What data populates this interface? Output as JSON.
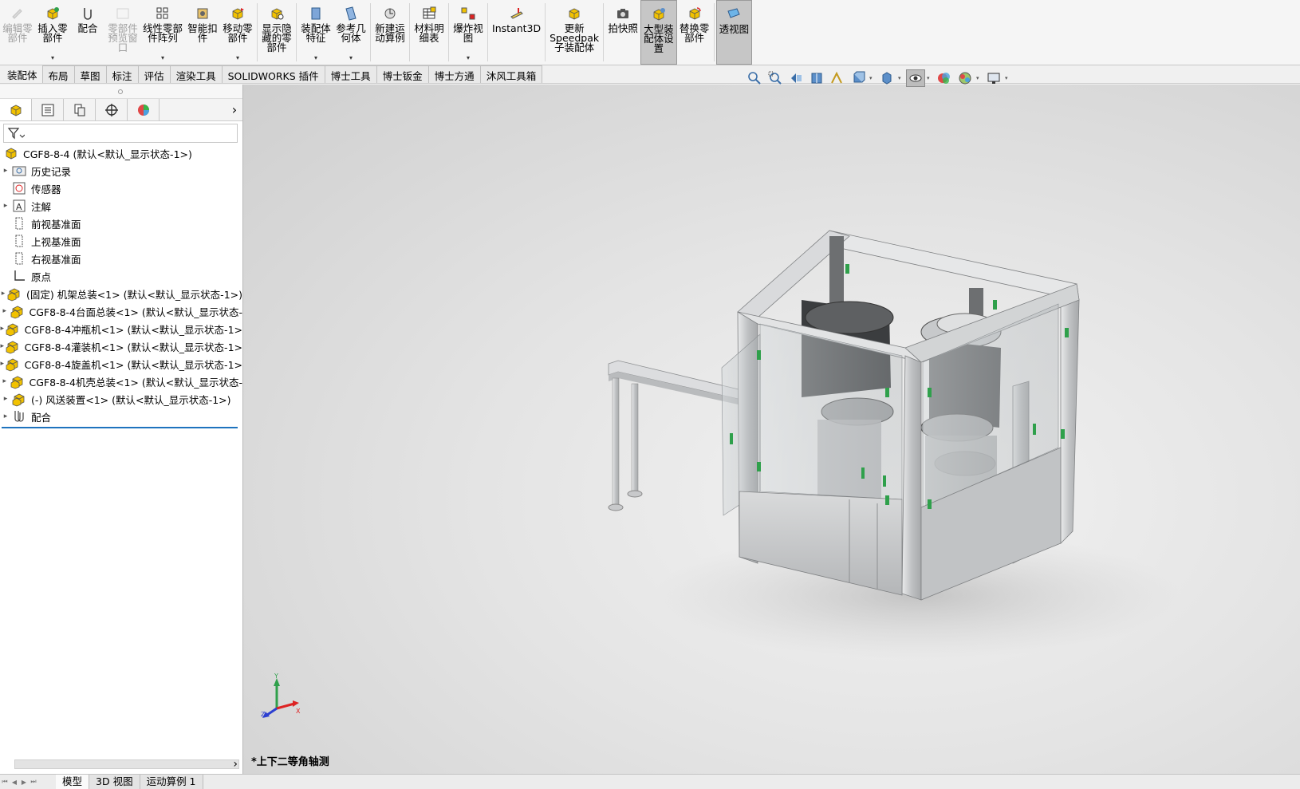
{
  "ribbon": {
    "buttons": [
      {
        "id": "edit-component",
        "label": "编辑零\n部件",
        "icon": "edit-component-icon",
        "disabled": true,
        "dropdown": false
      },
      {
        "id": "insert-component",
        "label": "插入零\n部件",
        "icon": "insert-component-icon",
        "disabled": false,
        "dropdown": true
      },
      {
        "id": "mate",
        "label": "配合",
        "icon": "mate-icon",
        "disabled": false,
        "dropdown": false
      },
      {
        "id": "component-preview",
        "label": "零部件\n预览窗\n口",
        "icon": "component-preview-icon",
        "disabled": true,
        "dropdown": false
      },
      {
        "id": "linear-pattern",
        "label": "线性零部\n件阵列",
        "icon": "linear-pattern-icon",
        "disabled": false,
        "dropdown": true
      },
      {
        "id": "smart-fasteners",
        "label": "智能扣\n件",
        "icon": "smart-fasteners-icon",
        "disabled": false,
        "dropdown": false
      },
      {
        "id": "move-component",
        "label": "移动零\n部件",
        "icon": "move-component-icon",
        "disabled": false,
        "dropdown": true
      },
      {
        "id": "show-hidden",
        "label": "显示隐\n藏的零\n部件",
        "icon": "show-hidden-icon",
        "disabled": false,
        "dropdown": false,
        "sep_before": true
      },
      {
        "id": "assembly-features",
        "label": "装配体\n特征",
        "icon": "assembly-features-icon",
        "disabled": false,
        "dropdown": true,
        "sep_before": true
      },
      {
        "id": "reference-geometry",
        "label": "参考几\n何体",
        "icon": "reference-geometry-icon",
        "disabled": false,
        "dropdown": true
      },
      {
        "id": "new-motion-study",
        "label": "新建运\n动算例",
        "icon": "motion-study-icon",
        "disabled": false,
        "dropdown": false,
        "sep_before": true
      },
      {
        "id": "bom",
        "label": "材料明\n细表",
        "icon": "bom-icon",
        "disabled": false,
        "dropdown": false,
        "sep_before": true
      },
      {
        "id": "exploded-view",
        "label": "爆炸视\n图",
        "icon": "exploded-view-icon",
        "disabled": false,
        "dropdown": true,
        "sep_before": true
      },
      {
        "id": "instant3d",
        "label": "Instant3D",
        "icon": "instant3d-icon",
        "disabled": false,
        "dropdown": false,
        "sep_before": true
      },
      {
        "id": "update-speedpak",
        "label": "更新\nSpeedpak\n子装配体",
        "icon": "speedpak-icon",
        "disabled": false,
        "dropdown": false,
        "sep_before": true
      },
      {
        "id": "snapshot",
        "label": "拍快照",
        "icon": "camera-icon",
        "disabled": false,
        "dropdown": false,
        "sep_before": true
      },
      {
        "id": "large-assembly",
        "label": "大型装\n配体设\n置",
        "icon": "large-assembly-icon",
        "disabled": false,
        "dropdown": false,
        "active": true
      },
      {
        "id": "replace-components",
        "label": "替换零\n部件",
        "icon": "replace-components-icon",
        "disabled": false,
        "dropdown": false
      },
      {
        "id": "perspective",
        "label": "透视图",
        "icon": "perspective-icon",
        "disabled": false,
        "dropdown": false,
        "active": true,
        "sep_before": true
      }
    ]
  },
  "command_tabs": [
    "装配体",
    "布局",
    "草图",
    "标注",
    "评估",
    "渲染工具",
    "SOLIDWORKS 插件",
    "博士工具",
    "博士钣金",
    "博士方通",
    "沐风工具箱"
  ],
  "heads_up": [
    {
      "icon": "zoom-to-fit-icon"
    },
    {
      "icon": "zoom-to-area-icon"
    },
    {
      "icon": "previous-view-icon"
    },
    {
      "icon": "section-view-icon"
    },
    {
      "icon": "dynamic-annotation-icon"
    },
    {
      "icon": "view-orientation-icon",
      "dropdown": true
    },
    {
      "icon": "display-style-icon",
      "dropdown": true
    },
    {
      "icon": "hide-show-items-icon",
      "dropdown": true,
      "selected": true
    },
    {
      "icon": "edit-appearance-icon",
      "dropdown": false
    },
    {
      "icon": "apply-scene-icon",
      "dropdown": true
    },
    {
      "icon": "view-settings-icon",
      "dropdown": true
    }
  ],
  "manager_tabs": [
    {
      "icon": "feature-manager-icon",
      "active": true
    },
    {
      "icon": "property-manager-icon"
    },
    {
      "icon": "configuration-manager-icon"
    },
    {
      "icon": "dimxpert-manager-icon"
    },
    {
      "icon": "display-manager-icon"
    }
  ],
  "tree": {
    "root": "CGF8-8-4  (默认<默认_显示状态-1>)",
    "items": [
      {
        "label": "历史记录",
        "icon": "history-folder-icon",
        "expandable": true
      },
      {
        "label": "传感器",
        "icon": "sensors-icon",
        "expandable": false
      },
      {
        "label": "注解",
        "icon": "annotations-icon",
        "expandable": true
      },
      {
        "label": "前视基准面",
        "icon": "plane-icon",
        "expandable": false
      },
      {
        "label": "上视基准面",
        "icon": "plane-icon",
        "expandable": false
      },
      {
        "label": "右视基准面",
        "icon": "plane-icon",
        "expandable": false
      },
      {
        "label": "原点",
        "icon": "origin-icon",
        "expandable": false
      },
      {
        "label": "(固定) 机架总装<1> (默认<默认_显示状态-1>)",
        "icon": "subassembly-icon",
        "expandable": true
      },
      {
        "label": "CGF8-8-4台面总装<1> (默认<默认_显示状态-",
        "icon": "subassembly-icon",
        "expandable": true
      },
      {
        "label": "CGF8-8-4冲瓶机<1> (默认<默认_显示状态-1>",
        "icon": "subassembly-icon",
        "expandable": true
      },
      {
        "label": "CGF8-8-4灌装机<1> (默认<默认_显示状态-1>",
        "icon": "subassembly-icon",
        "expandable": true
      },
      {
        "label": "CGF8-8-4旋盖机<1> (默认<默认_显示状态-1>",
        "icon": "subassembly-icon",
        "expandable": true
      },
      {
        "label": "CGF8-8-4机壳总装<1> (默认<默认_显示状态-",
        "icon": "subassembly-icon",
        "expandable": true
      },
      {
        "label": "(-) 风送装置<1> (默认<默认_显示状态-1>)",
        "icon": "subassembly-icon",
        "expandable": true
      },
      {
        "label": "配合",
        "icon": "mates-icon",
        "expandable": true
      }
    ]
  },
  "viewport": {
    "view_name": "*上下二等角轴测",
    "triad": {
      "x": "X",
      "y": "Y",
      "z": "Z"
    }
  },
  "bottom_tabs": [
    "模型",
    "3D 视图",
    "运动算例 1"
  ],
  "colors": {
    "accent_blue": "#1e73be",
    "assembly_yellow": "#f2c200",
    "handle_green": "#2fa04b",
    "machine_steel": "#cfd1d3"
  }
}
